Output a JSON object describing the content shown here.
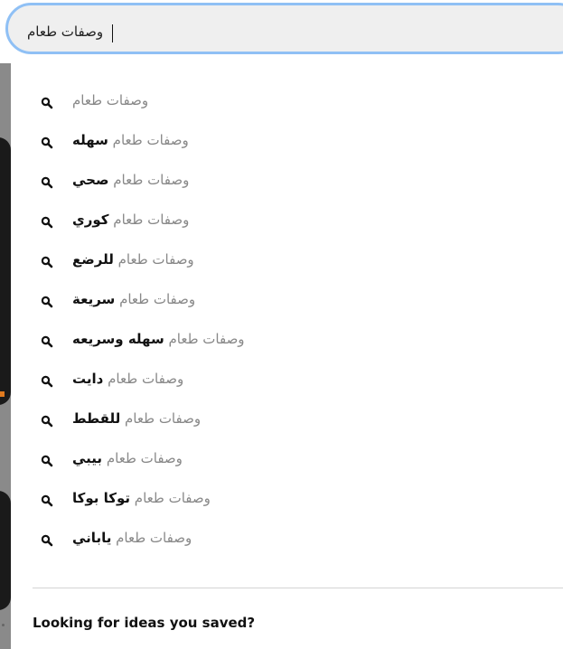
{
  "search": {
    "value": "وصفات طعام",
    "placeholder": ""
  },
  "suggestions": [
    {
      "query": "وصفات طعام",
      "suffix": ""
    },
    {
      "query": "وصفات طعام",
      "suffix": "سهله"
    },
    {
      "query": "وصفات طعام",
      "suffix": "صحي"
    },
    {
      "query": "وصفات طعام",
      "suffix": "كوري"
    },
    {
      "query": "وصفات طعام",
      "suffix": "للرضع"
    },
    {
      "query": "وصفات طعام",
      "suffix": "سريعة"
    },
    {
      "query": "وصفات طعام",
      "suffix": "سهله وسريعه"
    },
    {
      "query": "وصفات طعام",
      "suffix": "دايت"
    },
    {
      "query": "وصفات طعام",
      "suffix": "للقطط"
    },
    {
      "query": "وصفات طعام",
      "suffix": "بيبي"
    },
    {
      "query": "وصفات طعام",
      "suffix": "توكا بوكا"
    },
    {
      "query": "وصفات طعام",
      "suffix": "ياباني"
    }
  ],
  "saved_ideas_label": "Looking for ideas you saved?",
  "icons": {
    "suggestion": "search-icon"
  },
  "colors": {
    "focus_ring": "#8fc0f5",
    "query_text": "#888888",
    "suffix_text": "#111111"
  }
}
